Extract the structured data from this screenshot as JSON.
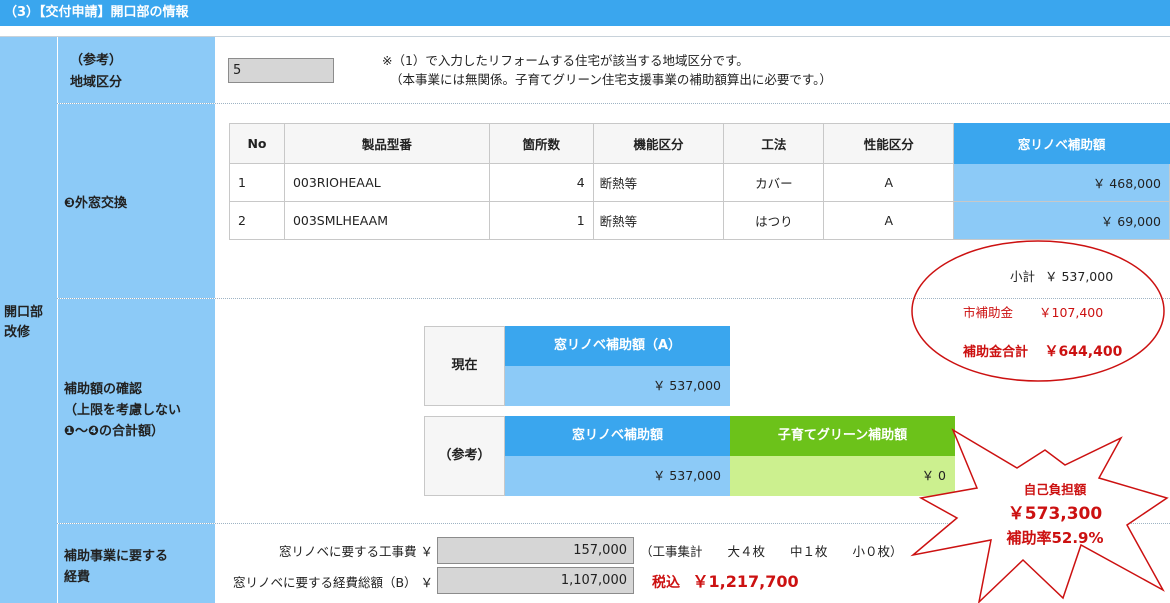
{
  "header": {
    "title": "（3）【交付申請】開口部の情報"
  },
  "side_label": {
    "line1": "開口部",
    "line2": "改修"
  },
  "region": {
    "label1": "（参考）",
    "label2": "地域区分",
    "value": "5",
    "note1": "※（1）で入力したリフォームする住宅が該当する地域区分です。",
    "note2": "（本事業には無関係。子育てグリーン住宅支援事業の補助額算出に必要です。）"
  },
  "windows": {
    "label": "❸外窓交換",
    "columns": [
      "No",
      "製品型番",
      "箇所数",
      "機能区分",
      "工法",
      "性能区分",
      "窓リノベ補助額"
    ],
    "rows": [
      {
        "no": "1",
        "model": "003RIOHEAAL",
        "count": "4",
        "func": "断熱等",
        "method": "カバー",
        "perf": "A",
        "amount": "￥ 468,000"
      },
      {
        "no": "2",
        "model": "003SMLHEAAM",
        "count": "1",
        "func": "断熱等",
        "method": "はつり",
        "perf": "A",
        "amount": "￥ 69,000"
      }
    ],
    "subtotal_label": "小計",
    "subtotal_value": "￥ 537,000"
  },
  "annotation_circle": {
    "city_label": "市補助金",
    "city_value": "￥107,400",
    "total_label": "補助金合計",
    "total_value": "￥644,400"
  },
  "confirm": {
    "label1": "補助額の確認",
    "label2": "（上限を考慮しない",
    "label3": "❶～❹の合計額）",
    "current_label": "現在",
    "current_header": "窓リノベ補助額（A）",
    "current_value": "￥ 537,000",
    "ref_label": "（参考）",
    "ref_header1": "窓リノベ補助額",
    "ref_header2": "子育てグリーン補助額",
    "ref_value1": "￥ 537,000",
    "ref_value2": "￥ 0"
  },
  "burst": {
    "line1": "自己負担額",
    "line2": "￥573,300",
    "line3": "補助率52.9%"
  },
  "cost": {
    "label1": "補助事業に要する",
    "label2": "経費",
    "work_label": "窓リノベに要する工事費 ￥",
    "work_value": "157,000",
    "work_note": "（工事集計　　大４枚　　中１枚　　小０枚）",
    "total_label": "窓リノベに要する経費総額（B） ￥",
    "total_value": "1,107,000",
    "tax_label": "税込",
    "tax_value": "￥1,217,700"
  },
  "colors": {
    "header": "#3aa6ee",
    "label_bg": "#8ccaf7",
    "green_header": "#6cc21a",
    "green_cell": "#ccf08f",
    "annotation_red": "#cc1111"
  }
}
